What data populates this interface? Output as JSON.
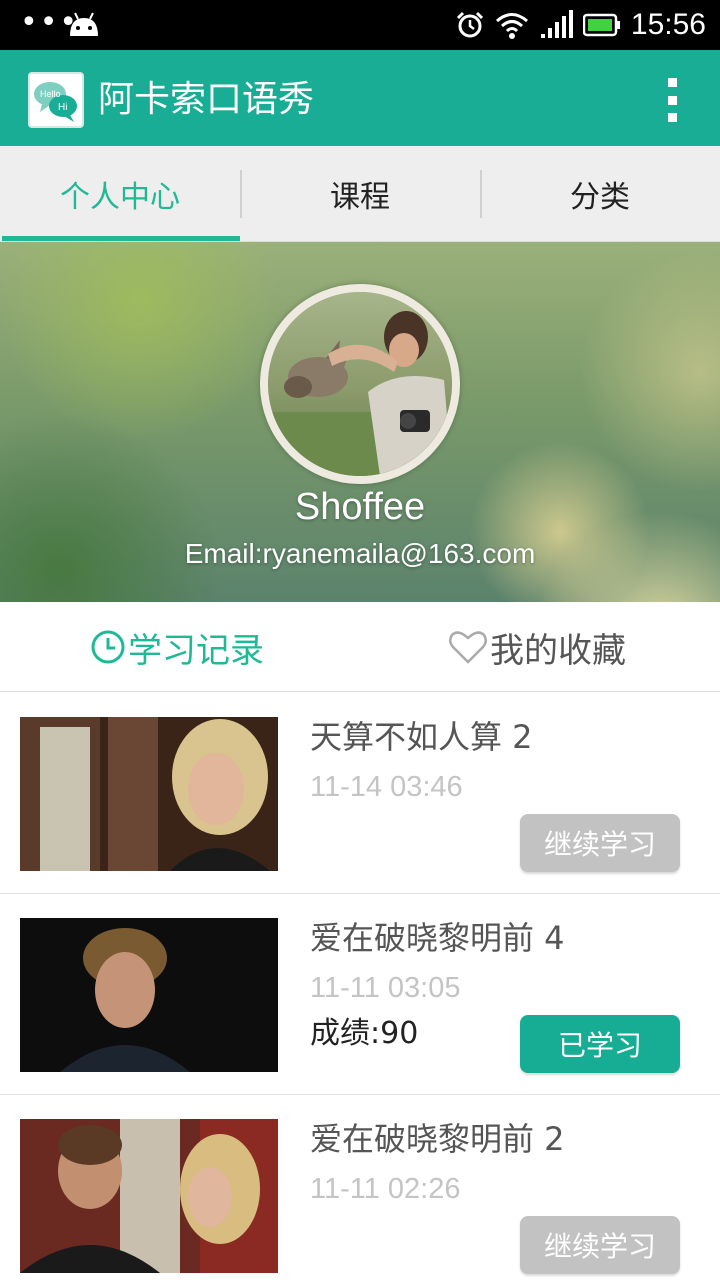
{
  "status_bar": {
    "time": "15:56",
    "icons": [
      "more-dots-icon",
      "android-icon",
      "alarm-icon",
      "wifi-icon",
      "signal-icon",
      "battery-icon"
    ]
  },
  "app_bar": {
    "logo_text_top": "Hello",
    "logo_text_bottom": "Hi",
    "title": "阿卡索口语秀",
    "accent_color": "#1aad95"
  },
  "tabs": [
    {
      "label": "个人中心",
      "active": true
    },
    {
      "label": "课程",
      "active": false
    },
    {
      "label": "分类",
      "active": false
    }
  ],
  "profile": {
    "username": "Shoffee",
    "email": "Email:ryanemaila@163.com"
  },
  "subtabs": {
    "history_label": "学习记录",
    "favorites_label": "我的收藏"
  },
  "records": [
    {
      "title": "天算不如人算 2",
      "time": "11-14 03:46",
      "score": "",
      "button": "继续学习",
      "button_style": "grey"
    },
    {
      "title": "爱在破晓黎明前 4",
      "time": "11-11 03:05",
      "score": "成绩:90",
      "button": "已学习",
      "button_style": "green"
    },
    {
      "title": "爱在破晓黎明前 2",
      "time": "11-11 02:26",
      "score": "",
      "button": "继续学习",
      "button_style": "grey"
    }
  ]
}
